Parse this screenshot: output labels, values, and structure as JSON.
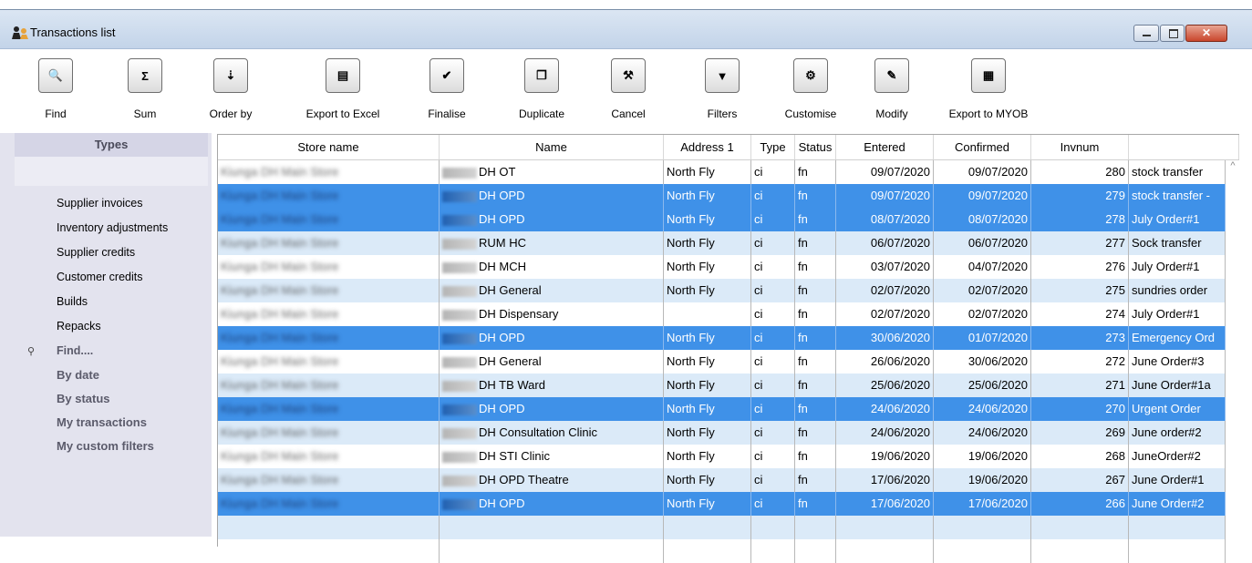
{
  "window": {
    "title": "Transactions list"
  },
  "toolbar": {
    "items": [
      {
        "label": "Find",
        "icon": "search-icon",
        "glyph": "🔍"
      },
      {
        "label": "Sum",
        "icon": "sigma-icon",
        "glyph": "Σ"
      },
      {
        "label": "Order by",
        "icon": "sort-icon",
        "glyph": "⇣"
      },
      {
        "label": "Export to Excel",
        "icon": "printer-icon",
        "glyph": "▤"
      },
      {
        "label": "Finalise",
        "icon": "checkmark-icon",
        "glyph": "✔"
      },
      {
        "label": "Duplicate",
        "icon": "cards-icon",
        "glyph": "❐"
      },
      {
        "label": "Cancel",
        "icon": "hammer-icon",
        "glyph": "⚒"
      },
      {
        "label": "Filters",
        "icon": "funnel-icon",
        "glyph": "▼"
      },
      {
        "label": "Customise",
        "icon": "gear-icon",
        "glyph": "⚙"
      },
      {
        "label": "Modify",
        "icon": "edit-icon",
        "glyph": "✎"
      },
      {
        "label": "Export to MYOB",
        "icon": "export-doc-icon",
        "glyph": "▦"
      }
    ]
  },
  "sidebar": {
    "header": "Types",
    "types": [
      "Supplier invoices",
      "Inventory adjustments",
      "Supplier credits",
      "Customer credits",
      "Builds",
      "Repacks"
    ],
    "filters": [
      "Find....",
      "By date",
      "By status",
      "My transactions",
      "My custom filters"
    ]
  },
  "table": {
    "columns": [
      "Store name",
      "Name",
      "Address 1",
      "Type",
      "Status",
      "Entered",
      "Confirmed",
      "Invnum",
      ""
    ],
    "rows": [
      {
        "store": "Kiunga DH Main Store",
        "name": "DH OT",
        "address": "North Fly",
        "type": "ci",
        "status": "fn",
        "entered": "09/07/2020",
        "confirmed": "09/07/2020",
        "invnum": "280",
        "comment": "stock transfer",
        "selected": false
      },
      {
        "store": "Kiunga DH Main Store",
        "name": "DH OPD",
        "address": "North Fly",
        "type": "ci",
        "status": "fn",
        "entered": "09/07/2020",
        "confirmed": "09/07/2020",
        "invnum": "279",
        "comment": "stock transfer -",
        "selected": true
      },
      {
        "store": "Kiunga DH Main Store",
        "name": "DH OPD",
        "address": "North Fly",
        "type": "ci",
        "status": "fn",
        "entered": "08/07/2020",
        "confirmed": "08/07/2020",
        "invnum": "278",
        "comment": "July Order#1",
        "selected": true
      },
      {
        "store": "Kiunga DH Main Store",
        "name": "RUM HC",
        "address": "North Fly",
        "type": "ci",
        "status": "fn",
        "entered": "06/07/2020",
        "confirmed": "06/07/2020",
        "invnum": "277",
        "comment": "Sock transfer",
        "selected": false
      },
      {
        "store": "Kiunga DH Main Store",
        "name": "DH MCH",
        "address": "North Fly",
        "type": "ci",
        "status": "fn",
        "entered": "03/07/2020",
        "confirmed": "04/07/2020",
        "invnum": "276",
        "comment": "July Order#1",
        "selected": false
      },
      {
        "store": "Kiunga DH Main Store",
        "name": "DH General",
        "address": "North Fly",
        "type": "ci",
        "status": "fn",
        "entered": "02/07/2020",
        "confirmed": "02/07/2020",
        "invnum": "275",
        "comment": "sundries order",
        "selected": false
      },
      {
        "store": "Kiunga DH Main Store",
        "name": "DH Dispensary",
        "address": "",
        "type": "ci",
        "status": "fn",
        "entered": "02/07/2020",
        "confirmed": "02/07/2020",
        "invnum": "274",
        "comment": "July Order#1",
        "selected": false
      },
      {
        "store": "Kiunga DH Main Store",
        "name": "DH OPD",
        "address": "North Fly",
        "type": "ci",
        "status": "fn",
        "entered": "30/06/2020",
        "confirmed": "01/07/2020",
        "invnum": "273",
        "comment": "Emergency Ord",
        "selected": true
      },
      {
        "store": "Kiunga DH Main Store",
        "name": "DH General",
        "address": "North Fly",
        "type": "ci",
        "status": "fn",
        "entered": "26/06/2020",
        "confirmed": "30/06/2020",
        "invnum": "272",
        "comment": "June Order#3",
        "selected": false
      },
      {
        "store": "Kiunga DH Main Store",
        "name": "DH TB Ward",
        "address": "North Fly",
        "type": "ci",
        "status": "fn",
        "entered": "25/06/2020",
        "confirmed": "25/06/2020",
        "invnum": "271",
        "comment": "June Order#1a",
        "selected": false
      },
      {
        "store": "Kiunga DH Main Store",
        "name": "DH OPD",
        "address": "North Fly",
        "type": "ci",
        "status": "fn",
        "entered": "24/06/2020",
        "confirmed": "24/06/2020",
        "invnum": "270",
        "comment": "Urgent Order",
        "selected": true
      },
      {
        "store": "Kiunga DH Main Store",
        "name": "DH Consultation Clinic",
        "address": "North Fly",
        "type": "ci",
        "status": "fn",
        "entered": "24/06/2020",
        "confirmed": "24/06/2020",
        "invnum": "269",
        "comment": "June order#2",
        "selected": false
      },
      {
        "store": "Kiunga DH Main Store",
        "name": "DH STI Clinic",
        "address": "North Fly",
        "type": "ci",
        "status": "fn",
        "entered": "19/06/2020",
        "confirmed": "19/06/2020",
        "invnum": "268",
        "comment": "JuneOrder#2",
        "selected": false
      },
      {
        "store": "Kiunga DH Main Store",
        "name": "DH OPD Theatre",
        "address": "North Fly",
        "type": "ci",
        "status": "fn",
        "entered": "17/06/2020",
        "confirmed": "19/06/2020",
        "invnum": "267",
        "comment": "June Order#1",
        "selected": false
      },
      {
        "store": "Kiunga DH Main Store",
        "name": "DH OPD",
        "address": "North Fly",
        "type": "ci",
        "status": "fn",
        "entered": "17/06/2020",
        "confirmed": "17/06/2020",
        "invnum": "266",
        "comment": "June Order#2",
        "selected": true
      }
    ]
  },
  "colors": {
    "selected_row": "#3f91e8",
    "alt_row": "#dbeaf8",
    "sidebar_bg": "#e3e3ee"
  }
}
